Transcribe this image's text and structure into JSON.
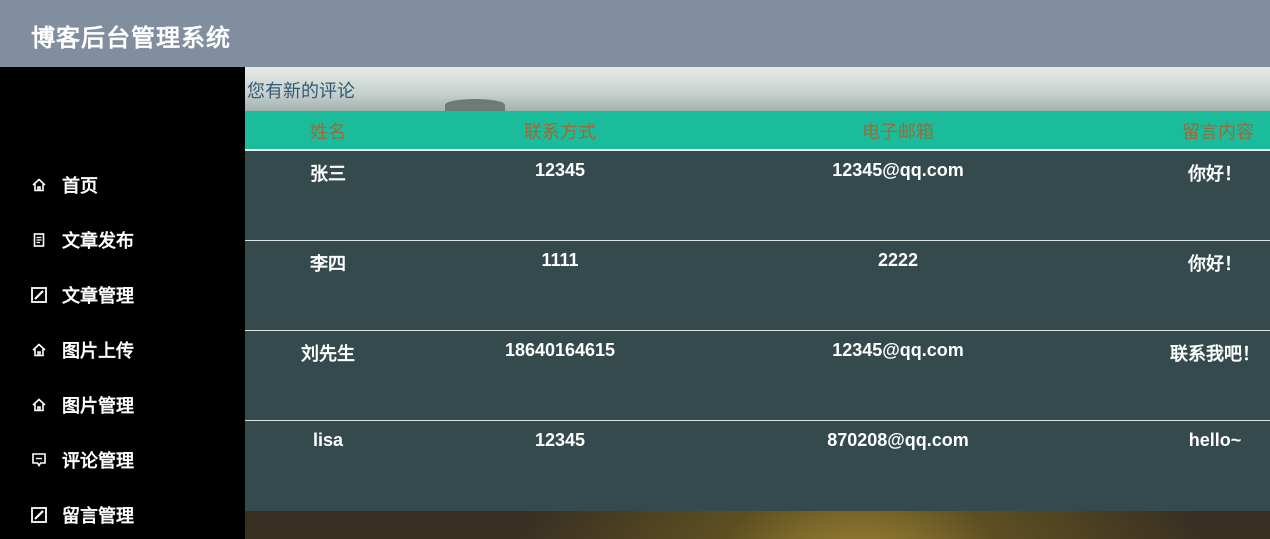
{
  "header": {
    "title": "博客后台管理系统"
  },
  "sidebar": {
    "items": [
      {
        "label": "首页",
        "icon": "home-icon"
      },
      {
        "label": "文章发布",
        "icon": "document-icon"
      },
      {
        "label": "文章管理",
        "icon": "edit-icon"
      },
      {
        "label": "图片上传",
        "icon": "home-icon"
      },
      {
        "label": "图片管理",
        "icon": "home-icon"
      },
      {
        "label": "评论管理",
        "icon": "comment-icon"
      },
      {
        "label": "留言管理",
        "icon": "edit-icon"
      }
    ]
  },
  "main": {
    "notice": "您有新的评论",
    "table": {
      "headers": [
        "姓名",
        "联系方式",
        "电子邮箱",
        "留言内容"
      ],
      "rows": [
        [
          "张三",
          "12345",
          "12345@qq.com",
          "你好！"
        ],
        [
          "李四",
          "1111",
          "2222",
          "你好！"
        ],
        [
          "刘先生",
          "18640164615",
          "12345@qq.com",
          "联系我吧！"
        ],
        [
          "lisa",
          "12345",
          "870208@qq.com",
          "hello~"
        ]
      ]
    }
  },
  "colors": {
    "header_bg": "#808ea0",
    "sidebar_bg": "#000000",
    "table_header_bg": "#1abc9c",
    "table_header_text": "#9a6b3a",
    "table_body_bg": "#344a4c",
    "notice_text": "#2f5a78"
  }
}
